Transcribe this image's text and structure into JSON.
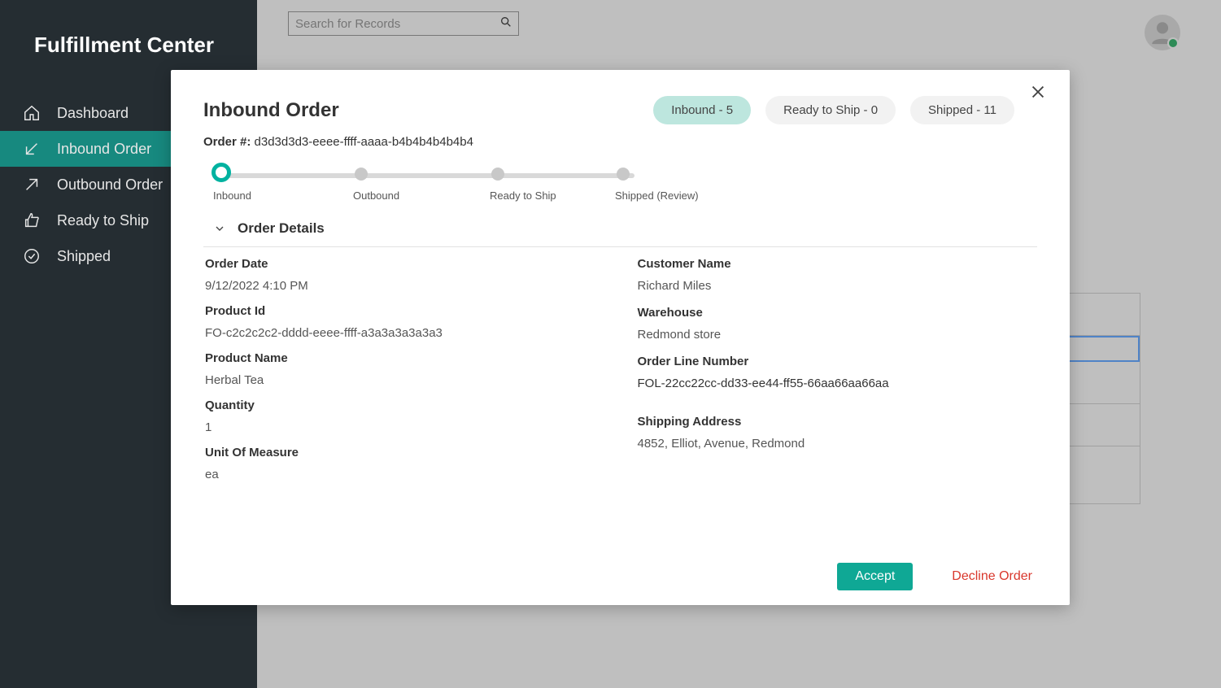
{
  "app": {
    "title": "Fulfillment Center"
  },
  "search": {
    "placeholder": "Search for Records"
  },
  "sidebar": {
    "items": [
      {
        "label": "Dashboard"
      },
      {
        "label": "Inbound Order"
      },
      {
        "label": "Outbound Order"
      },
      {
        "label": "Ready to Ship"
      },
      {
        "label": "Shipped"
      }
    ]
  },
  "pills": {
    "inbound": "Inbound - 5",
    "ready": "Ready to Ship - 0",
    "shipped": "Shipped - 11"
  },
  "modal": {
    "title": "Inbound Order",
    "orderNumLabel": "Order #:",
    "orderNum": "d3d3d3d3-eeee-ffff-aaaa-b4b4b4b4b4b4",
    "stepper": {
      "s0": "Inbound",
      "s1": "Outbound",
      "s2": "Ready to Ship",
      "s3": "Shipped (Review)"
    },
    "sectionTitle": "Order Details",
    "left": {
      "orderDate": {
        "label": "Order Date",
        "value": "9/12/2022 4:10 PM"
      },
      "productId": {
        "label": "Product Id",
        "prefix": "FO-",
        "value": "c2c2c2c2-dddd-eeee-ffff-a3a3a3a3a3a3"
      },
      "productName": {
        "label": "Product Name",
        "value": "Herbal Tea"
      },
      "quantity": {
        "label": "Quantity",
        "value": "1"
      },
      "uom": {
        "label": "Unit Of Measure",
        "value": "ea"
      }
    },
    "right": {
      "customerName": {
        "label": "Customer Name",
        "value": "Richard Miles"
      },
      "warehouse": {
        "label": "Warehouse",
        "value": "Redmond store"
      },
      "orderLine": {
        "label": "Order Line Number",
        "prefix": "FOL-",
        "value": "22cc22cc-dd33-ee44-ff55-66aa66aa66aa"
      },
      "shippingAddress": {
        "label": "Shipping Address",
        "value": "4852, Elliot, Avenue, Redmond"
      }
    },
    "actions": {
      "accept": "Accept",
      "decline": "Decline Order"
    }
  }
}
